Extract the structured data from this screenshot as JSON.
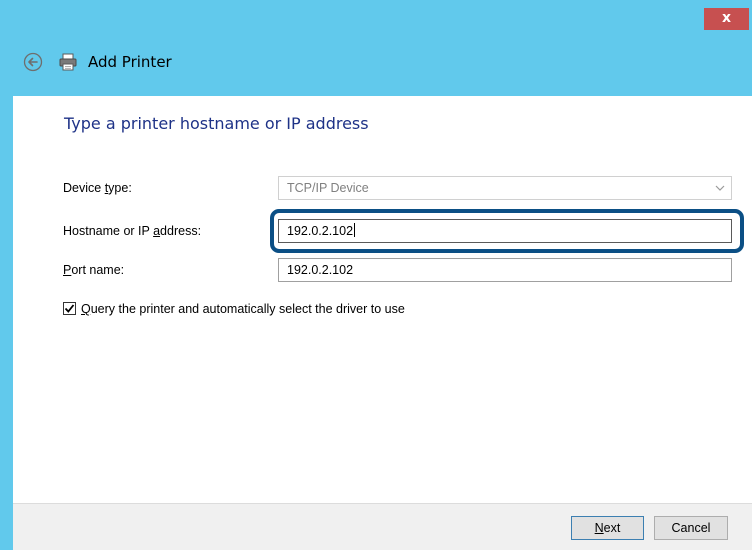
{
  "window": {
    "title": "Add Printer",
    "close_glyph": "x",
    "accent_color": "#61c9ec",
    "close_color": "#c75050"
  },
  "icons": {
    "back": "back-arrow-icon",
    "printer": "printer-icon",
    "check": "checkmark-icon",
    "dropdown": "chevron-down-icon"
  },
  "page": {
    "heading": "Type a printer hostname or IP address"
  },
  "form": {
    "device_type": {
      "label_pre": "Device ",
      "label_key": "t",
      "label_post": "ype:",
      "value": "TCP/IP Device"
    },
    "hostname": {
      "label_pre": "Hostname or IP ",
      "label_key": "a",
      "label_post": "ddress:",
      "value": "192.0.2.102"
    },
    "port": {
      "label_pre": "",
      "label_key": "P",
      "label_post": "ort name:",
      "value": "192.0.2.102"
    },
    "query_checkbox": {
      "checked": true,
      "label_pre": "",
      "label_key": "Q",
      "label_post": "uery the printer and automatically select the driver to use"
    }
  },
  "buttons": {
    "next_key": "N",
    "next_rest": "ext",
    "cancel": "Cancel"
  }
}
